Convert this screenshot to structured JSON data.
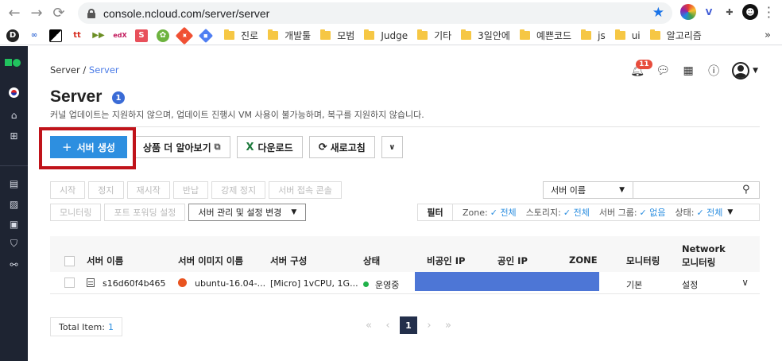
{
  "browser": {
    "url": "console.ncloud.com/server/server",
    "bookmarks": [
      "진로",
      "개발툴",
      "모범",
      "Judge",
      "기타",
      "3일안에",
      "예쁜코드",
      "js",
      "ui",
      "알고리즘"
    ],
    "more": "»"
  },
  "breadcrumb": {
    "root": "Server /",
    "current": "Server"
  },
  "header": {
    "notification_count": "11"
  },
  "page": {
    "title": "Server",
    "count_badge": "1",
    "notice": "커널 업데이트는 지원하지 않으며, 업데이트 진행시 VM 사용이 불가능하며, 복구를 지원하지 않습니다."
  },
  "toolbar": {
    "create": "서버 생성",
    "more_info": "상품 더 알아보기",
    "download": "다운로드",
    "refresh": "새로고침"
  },
  "actions": {
    "row1": [
      "시작",
      "정지",
      "재시작",
      "반납",
      "강제 정지",
      "서버 접속 콘솔"
    ],
    "row2": [
      "모니터링",
      "포트 포워딩 설정"
    ],
    "manage": "서버 관리 및 설정 변경"
  },
  "search": {
    "field": "서버 이름",
    "value": ""
  },
  "filter": {
    "label": "필터",
    "zone_label": "Zone:",
    "zone_value": "전체",
    "storage_label": "스토리지:",
    "storage_value": "전체",
    "group_label": "서버 그룹:",
    "group_value": "없음",
    "status_label": "상태:",
    "status_value": "전체"
  },
  "table": {
    "headers": {
      "name": "서버 이름",
      "image": "서버 이미지 이름",
      "spec": "서버 구성",
      "status": "상태",
      "private_ip": "비공인 IP",
      "public_ip": "공인 IP",
      "zone": "ZONE",
      "monitoring": "모니터링",
      "network_line1": "Network",
      "network_line2": "모니터링"
    },
    "rows": [
      {
        "name": "s16d60f4b465",
        "image": "ubuntu-16.04-...",
        "spec": "[Micro] 1vCPU, 1G...",
        "status": "운영중",
        "monitoring": "기본",
        "network": "설정"
      }
    ]
  },
  "footer": {
    "total_label": "Total Item:",
    "total_count": "1",
    "current_page": "1"
  },
  "colors": {
    "primary": "#2d8fe0",
    "sidebar": "#1e2432",
    "highlight": "#c0131a",
    "redacted": "#4d76d6"
  }
}
